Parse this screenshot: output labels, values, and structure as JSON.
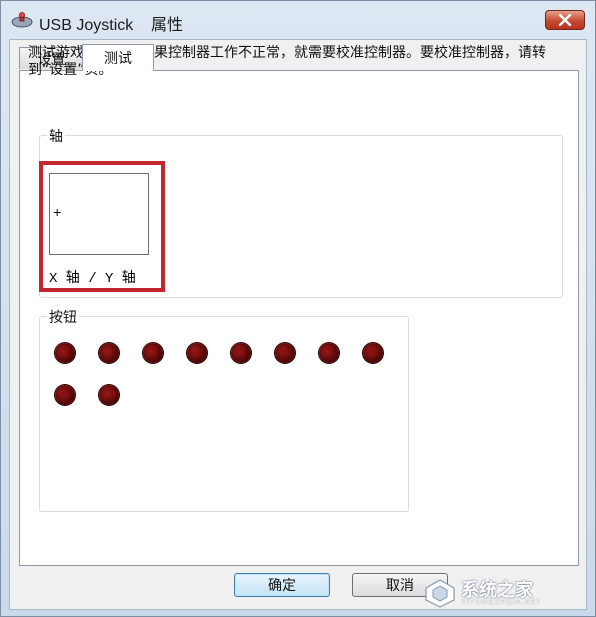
{
  "window": {
    "title": "USB Joystick",
    "title_suffix": "属性"
  },
  "tabs": [
    {
      "label": "设置",
      "active": false
    },
    {
      "label": "测试",
      "active": true
    }
  ],
  "description": "测试游戏控制器。如果控制器工作不正常，就需要校准控制器。要校准控制器，请转到“设置”页。",
  "axes_group": {
    "label": "轴",
    "caption": "X 轴 / Y 轴",
    "crosshair": "+"
  },
  "buttons_group": {
    "label": "按钮",
    "buttons": [
      "1",
      "2",
      "3",
      "4",
      "5",
      "6",
      "7",
      "8",
      "9",
      "10"
    ]
  },
  "footer": {
    "ok_label": "确定",
    "cancel_label": "取消"
  },
  "watermark": {
    "text": "系统之家",
    "sub": "XITONGZHIJIA.NET"
  },
  "colors": {
    "highlight": "#c1272d",
    "button_indicator": "#7a0a0a",
    "close_button": "#c74a32"
  }
}
